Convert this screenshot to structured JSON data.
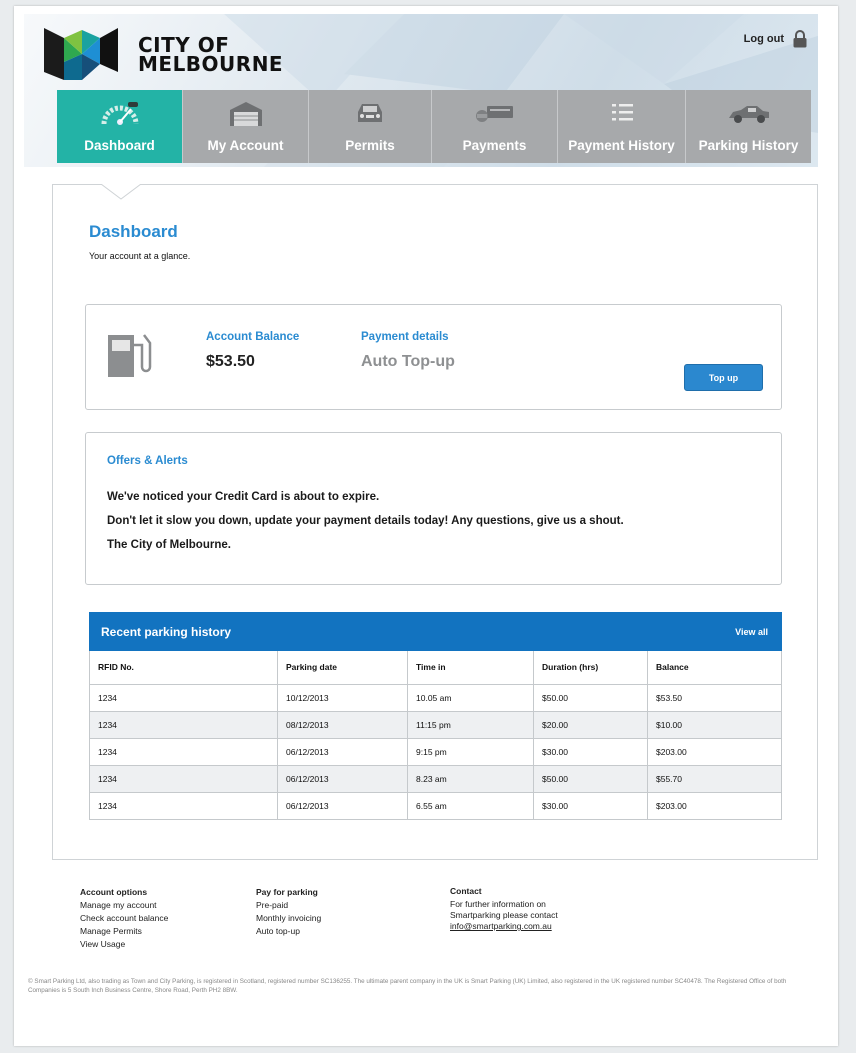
{
  "header": {
    "logo_line1": "CITY OF",
    "logo_line2": "MELBOURNE",
    "logout_label": "Log out"
  },
  "nav": [
    {
      "label": "Dashboard",
      "icon": "speedometer-icon",
      "active": true
    },
    {
      "label": "My Account",
      "icon": "garage-icon",
      "active": false
    },
    {
      "label": "Permits",
      "icon": "car-front-icon",
      "active": false
    },
    {
      "label": "Payments",
      "icon": "card-payment-icon",
      "active": false
    },
    {
      "label": "Payment History",
      "icon": "list-icon",
      "active": false
    },
    {
      "label": "Parking History",
      "icon": "car-side-icon",
      "active": false
    }
  ],
  "page": {
    "title": "Dashboard",
    "subtitle": "Your account at a glance."
  },
  "balance": {
    "balance_label": "Account Balance",
    "balance_value": "$53.50",
    "payment_label": "Payment details",
    "payment_value": "Auto Top-up",
    "topup_label": "Top up"
  },
  "offers": {
    "title": "Offers & Alerts",
    "line1": "We've noticed your Credit Card is about to expire.",
    "line2": "Don't let it slow you down, update your payment details today! Any questions, give us a shout.",
    "line3": "The City of Melbourne."
  },
  "history": {
    "title": "Recent parking history",
    "view_all": "View all",
    "columns": [
      "RFID No.",
      "Parking date",
      "Time in",
      "Duration (hrs)",
      "Balance"
    ],
    "rows": [
      [
        "1234",
        "10/12/2013",
        "10.05 am",
        "$50.00",
        "$53.50"
      ],
      [
        "1234",
        "08/12/2013",
        "11:15 pm",
        "$20.00",
        "$10.00"
      ],
      [
        "1234",
        "06/12/2013",
        "9:15 pm",
        "$30.00",
        "$203.00"
      ],
      [
        "1234",
        "06/12/2013",
        "8.23 am",
        "$50.00",
        "$55.70"
      ],
      [
        "1234",
        "06/12/2013",
        "6.55 am",
        "$30.00",
        "$203.00"
      ]
    ]
  },
  "footer": {
    "col1": {
      "title": "Account options",
      "links": [
        "Manage my account",
        "Check account balance",
        "Manage Permits",
        "View Usage"
      ]
    },
    "col2": {
      "title": "Pay for parking",
      "links": [
        "Pre-paid",
        "Monthly invoicing",
        "Auto top-up"
      ]
    },
    "col3": {
      "title": "Contact",
      "line1": "For further information on",
      "line2": "Smartparking please contact",
      "email": "info@smartparking.com.au"
    },
    "legal": "© Smart Parking Ltd, also trading as Town and City Parking, is registered in Scotland, registered number SC136255. The ultimate parent company in the UK is Smart Parking (UK) Limited, also registered in the UK registered number SC40478. The Registered Office of both Companies is 5 South Inch Business Centre, Shore Road, Perth PH2 8BW."
  },
  "colors": {
    "active_tab": "#23b3a6",
    "inactive_tab": "#a7a9ab",
    "accent_blue": "#2a8bd1",
    "table_header": "#1273c0"
  }
}
